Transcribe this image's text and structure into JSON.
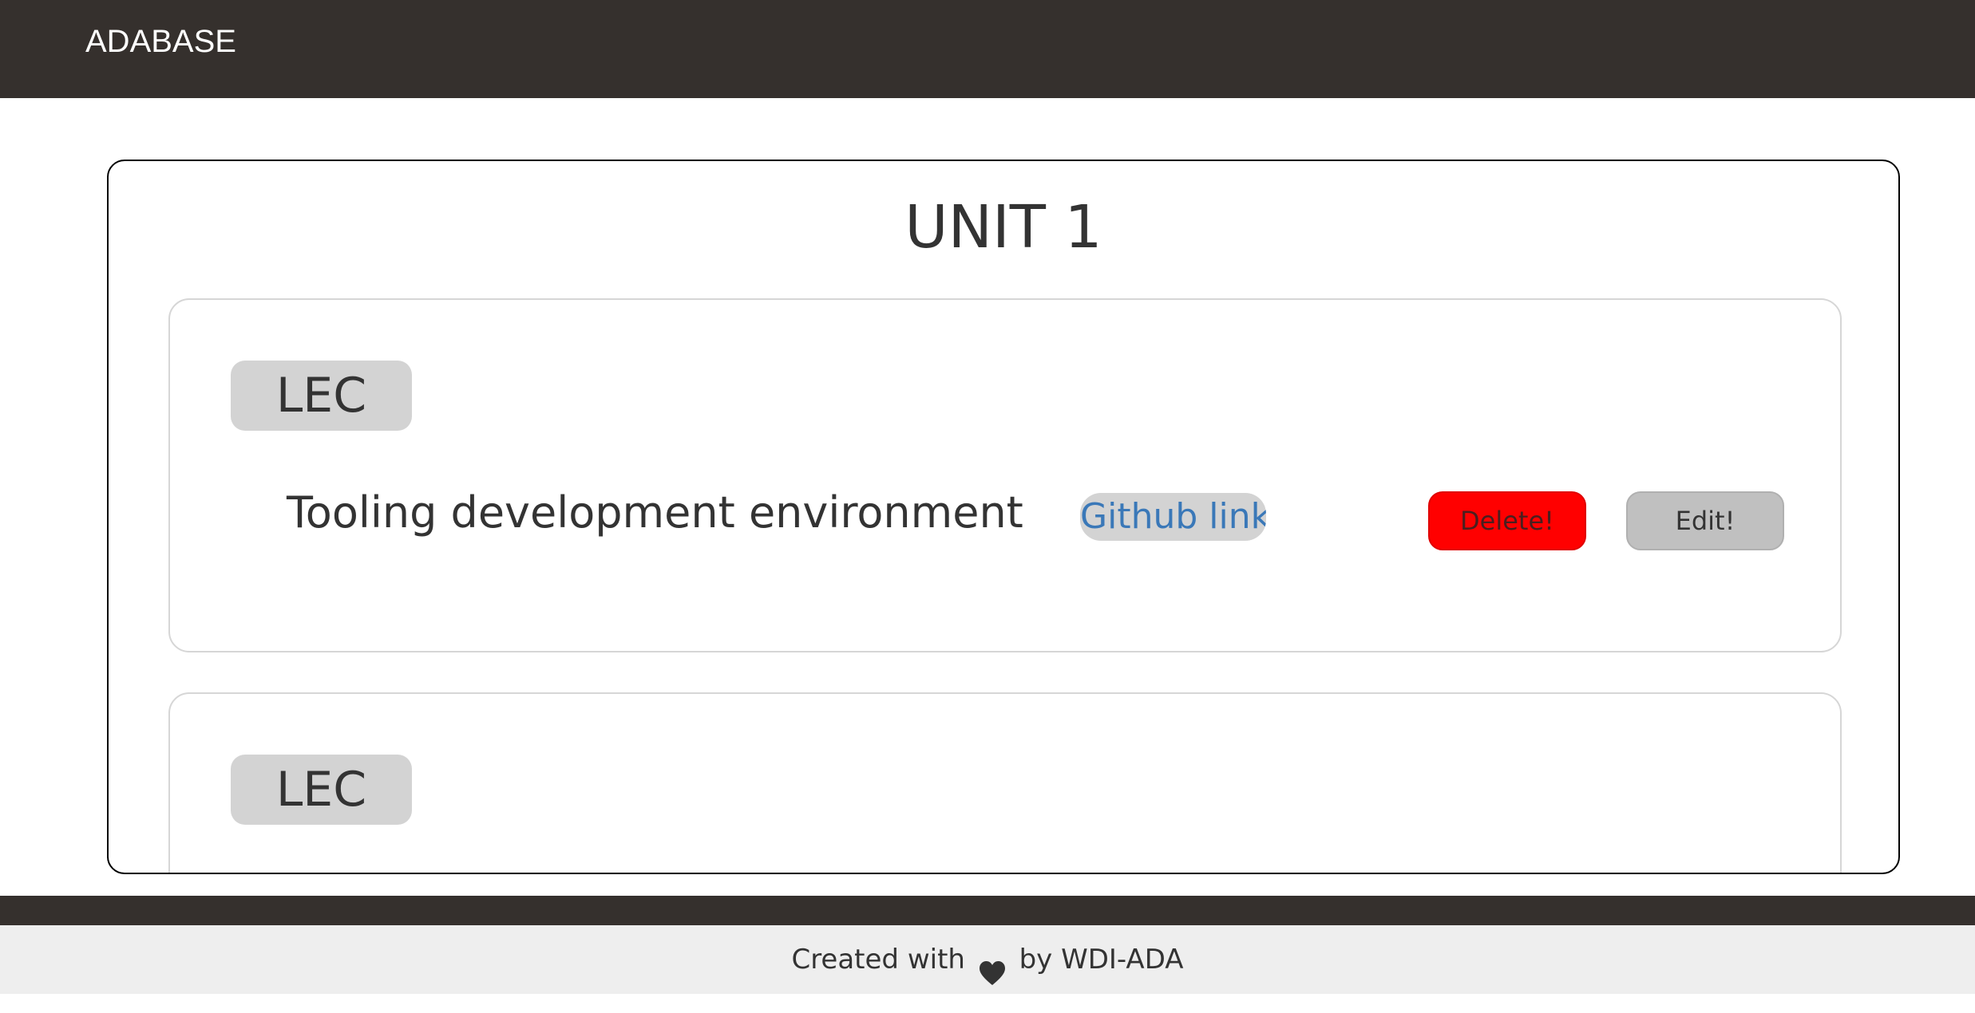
{
  "navbar": {
    "brand": "ADABASE"
  },
  "unit": {
    "title": "UNIT 1",
    "lessons": [
      {
        "type": "LEC",
        "title": "Tooling development environment",
        "github_label": "Github link",
        "delete_label": "Delete!",
        "edit_label": "Edit!"
      },
      {
        "type": "LEC"
      }
    ]
  },
  "footer": {
    "prefix": "Created with",
    "icon": "heart-icon",
    "suffix": "by WDI-ADA"
  },
  "colors": {
    "navbar": "#35302d",
    "delete_button": "#ff0000",
    "edit_button": "#c0c0c0",
    "link": "#3a78b8",
    "badge": "#d3d3d3"
  }
}
